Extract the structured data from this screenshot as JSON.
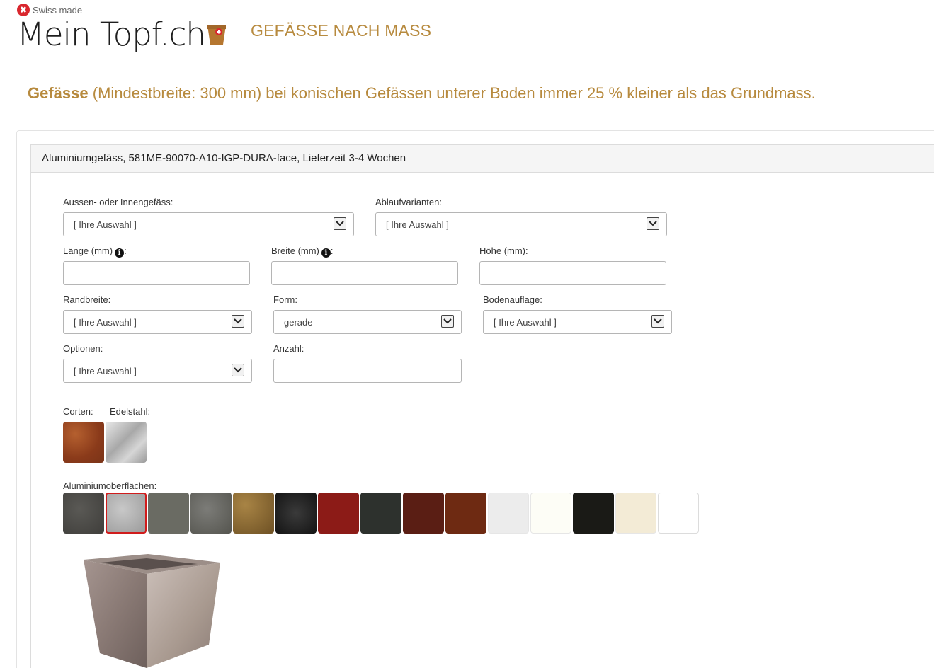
{
  "header": {
    "swiss_badge": "Swiss made",
    "logo": "Mein Topf.ch",
    "tagline": "GEFÄSSE NACH MASS"
  },
  "headline": {
    "strong": "Gefässe",
    "rest": " (Mindestbreite: 300 mm) bei konischen Gefässen unterer Boden immer 25 % kleiner als das Grundmass."
  },
  "panel": {
    "title": "Aluminiumgefäss, 581ME-90070-A10-IGP-DURA-face, Lieferzeit 3-4 Wochen"
  },
  "form": {
    "aussen_label": "Aussen- oder Innengefäss:",
    "aussen_value": "[ Ihre Auswahl ]",
    "ablauf_label": "Ablaufvarianten:",
    "ablauf_value": "[ Ihre Auswahl ]",
    "laenge_label": "Länge (mm)",
    "laenge_colon": ":",
    "laenge_value": "",
    "breite_label": "Breite (mm)",
    "breite_colon": ":",
    "breite_value": "",
    "hoehe_label": "Höhe (mm):",
    "hoehe_value": "",
    "rand_label": "Randbreite:",
    "rand_value": "[ Ihre Auswahl ]",
    "form_label": "Form:",
    "form_value": "gerade",
    "boden_label": "Bodenauflage:",
    "boden_value": "[ Ihre Auswahl ]",
    "optionen_label": "Optionen:",
    "optionen_value": "[ Ihre Auswahl ]",
    "anzahl_label": "Anzahl:",
    "anzahl_value": ""
  },
  "materials": {
    "corten_label": "Corten:",
    "edelstahl_label": "Edelstahl:",
    "alu_label": "Aluminiumoberflächen:"
  },
  "colors": {
    "accent": "#b78a3e",
    "selected_border": "#d01c1c",
    "swiss_red": "#d9272e"
  },
  "icons": {
    "info": "info-circle-icon",
    "dropdown": "chevron-down-icon"
  }
}
